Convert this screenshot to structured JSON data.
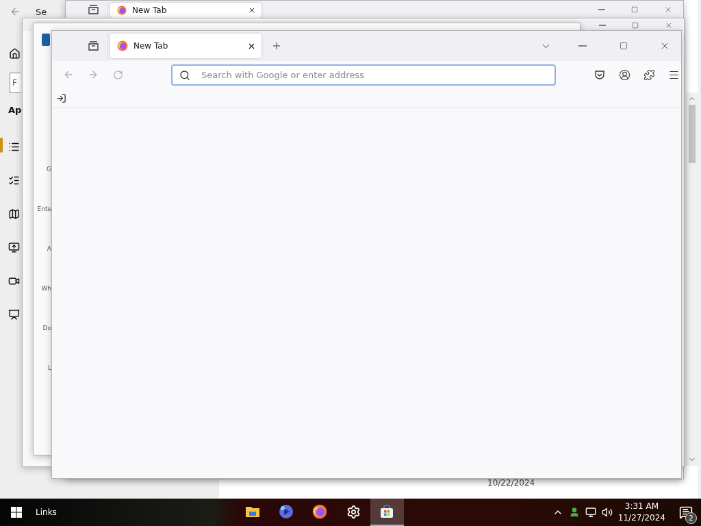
{
  "settings_window": {
    "title": "Se",
    "search_placeholder": "F",
    "heading": "Ap",
    "nav_items": [
      {
        "kind": "list",
        "selected": true
      },
      {
        "kind": "checklist",
        "selected": false
      },
      {
        "kind": "map",
        "selected": false
      },
      {
        "kind": "upload",
        "selected": false
      },
      {
        "kind": "video",
        "selected": false
      },
      {
        "kind": "presentation",
        "selected": false
      }
    ],
    "date": "10/22/2024"
  },
  "back_browser": {
    "tab_title": "New Tab"
  },
  "back_window": {
    "labels": [
      "G",
      "Ente",
      "A",
      "Wh",
      "Do",
      "L"
    ]
  },
  "browser": {
    "tab": {
      "title": "New Tab",
      "selected": true
    },
    "search": {
      "placeholder": "Search with Google or enter address"
    }
  },
  "taskbar": {
    "toolbar_label": "Links",
    "apps": [
      {
        "kind": "explorer",
        "selected": false
      },
      {
        "kind": "copilot",
        "selected": false
      },
      {
        "kind": "firefox",
        "selected": false
      },
      {
        "kind": "settings",
        "selected": false
      },
      {
        "kind": "store",
        "selected": true
      }
    ],
    "time": "3:31 AM",
    "date": "11/27/2024",
    "notification_count": "2"
  }
}
